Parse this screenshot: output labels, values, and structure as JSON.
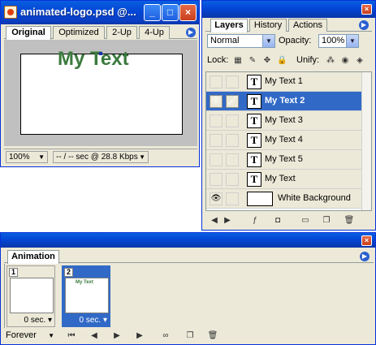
{
  "doc_window": {
    "title": "animated-logo.psd @...",
    "minimize": "_",
    "maximize": "□",
    "close": "×",
    "tabs": [
      "Original",
      "Optimized",
      "2-Up",
      "4-Up"
    ],
    "canvas_text": "My Text",
    "zoom": "100%",
    "status": "-- / -- sec @ 28.8 Kbps",
    "text_color": "#3b7a3e"
  },
  "layers_palette": {
    "tabs": [
      "Layers",
      "History",
      "Actions"
    ],
    "blend_mode": "Normal",
    "opacity_label": "Opacity:",
    "opacity_value": "100%",
    "lock_label": "Lock:",
    "unify_label": "Unify:",
    "layers": [
      {
        "name": "My Text 1",
        "visible": false,
        "selected": false,
        "kind": "text"
      },
      {
        "name": "My Text 2",
        "visible": true,
        "selected": true,
        "kind": "text"
      },
      {
        "name": "My Text 3",
        "visible": false,
        "selected": false,
        "kind": "text"
      },
      {
        "name": "My Text 4",
        "visible": false,
        "selected": false,
        "kind": "text"
      },
      {
        "name": "My Text 5",
        "visible": false,
        "selected": false,
        "kind": "text"
      },
      {
        "name": "My Text",
        "visible": false,
        "selected": false,
        "kind": "text"
      },
      {
        "name": "White Background",
        "visible": true,
        "selected": false,
        "kind": "raster"
      }
    ],
    "selection_color": "#3169c6"
  },
  "animation_palette": {
    "tab": "Animation",
    "frames": [
      {
        "number": "1",
        "delay": "0 sec.",
        "selected": false,
        "preview": ""
      },
      {
        "number": "2",
        "delay": "0 sec.",
        "selected": true,
        "preview": "My Text"
      }
    ],
    "loop": "Forever"
  }
}
